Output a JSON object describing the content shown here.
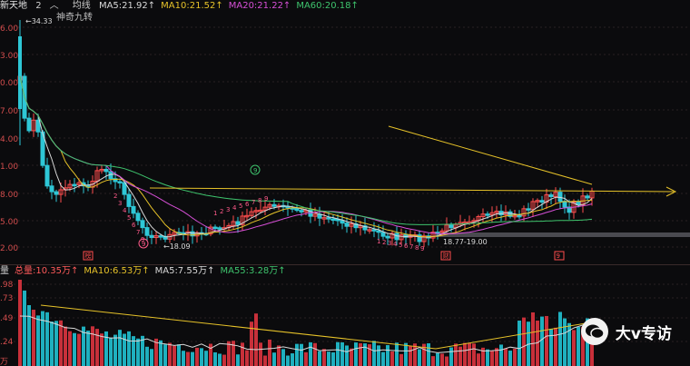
{
  "stock_name": "新天地",
  "period_tab": "2",
  "indicator_label": "均线",
  "ma_legend": [
    {
      "label": "MA5:21.92",
      "color": "#d9d9d9"
    },
    {
      "label": "MA10:21.52",
      "color": "#e6c229"
    },
    {
      "label": "MA20:21.22",
      "color": "#d64fd6"
    },
    {
      "label": "MA60:20.18",
      "color": "#3ec46d"
    }
  ],
  "overlay_label": "神奇九转",
  "price_axis_labels": [
    "6.00",
    "3.00",
    "0.00",
    "7.00",
    "4.00",
    "1.00",
    "8.00",
    "5.00",
    "2.00"
  ],
  "annotations": {
    "high": "34.33",
    "low_left": "18.09",
    "range_mid": "18.77-19.00"
  },
  "td_counts_a": [
    "2",
    "3",
    "4",
    "5",
    "6",
    "7",
    "9"
  ],
  "td_counts_b": [
    "1",
    "2",
    "3",
    "4",
    "5",
    "6",
    "7",
    "8",
    "9"
  ],
  "td_counts_c": [
    "1",
    "2",
    "3",
    "4",
    "5",
    "6",
    "7",
    "8",
    "9"
  ],
  "marker_labels": {
    "circle_top": "9",
    "circle_low": "9",
    "box1": "榜",
    "box2": "财",
    "box3": "9"
  },
  "volume_header": [
    {
      "label": "量",
      "color": "#cfcfcf"
    },
    {
      "label": "总量:10.35万",
      "color": "#ff5a5a"
    },
    {
      "label": "MA10:6.53万",
      "color": "#e6c229"
    },
    {
      "label": "MA5:7.55万",
      "color": "#d9d9d9"
    },
    {
      "label": "MA55:3.28万",
      "color": "#3ec46d"
    }
  ],
  "volume_axis_labels": [
    ".98",
    ".73",
    ".49",
    ".24",
    "万"
  ],
  "watermark": "大v专访"
}
